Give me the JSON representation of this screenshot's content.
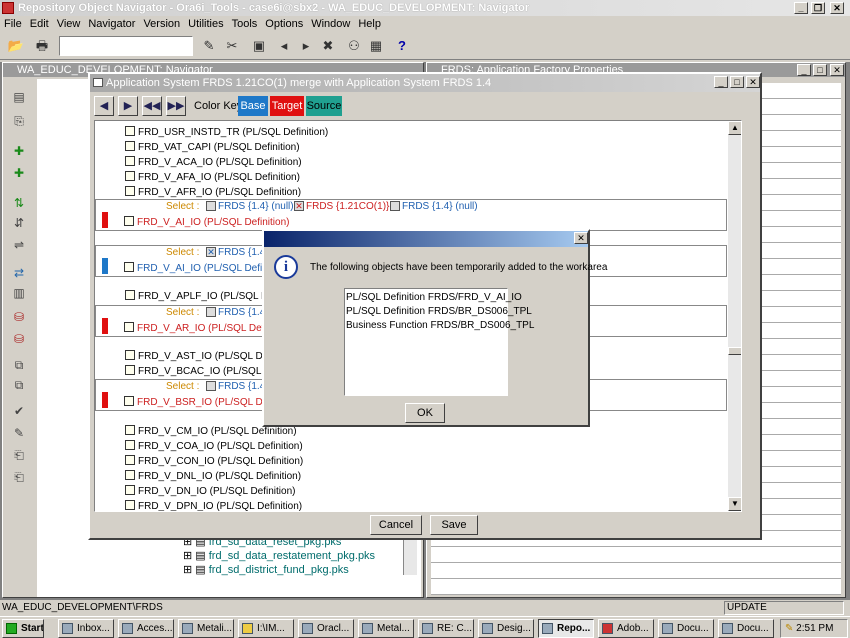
{
  "app": {
    "title": "Repository Object Navigator - Ora6i_Tools - case6i@sbx2 - WA_EDUC_DEVELOPMENT: Navigator"
  },
  "menu": [
    "File",
    "Edit",
    "View",
    "Navigator",
    "Version",
    "Utilities",
    "Tools",
    "Options",
    "Window",
    "Help"
  ],
  "left_window": {
    "title": "WA_EDUC_DEVELOPMENT: Navigator"
  },
  "right_window": {
    "title": "FRDS: Application Factory Properties"
  },
  "merge_dialog": {
    "title": "Application System  FRDS 1.21CO(1)  merge with Application System  FRDS 1.4",
    "color_key_label": "Color Key :",
    "key_base": "Base",
    "key_target": "Target",
    "key_source": "Source",
    "rows": [
      "FRD_USR_INSTD_TR (PL/SQL Definition)",
      "FRD_VAT_CAPI (PL/SQL Definition)",
      "FRD_V_ACA_IO (PL/SQL Definition)",
      "FRD_V_AFA_IO (PL/SQL Definition)",
      "FRD_V_AFR_IO (PL/SQL Definition)",
      "FRD_V_AI_IO (PL/SQL Definition)",
      "FRD_V_AI_IO (PL/SQL Definitio",
      "FRD_V_APLF_IO (PL/SQL Defin",
      "FRD_V_AR_IO (PL/SQL Definiti",
      "FRD_V_AST_IO (PL/SQL Defini",
      "FRD_V_BCAC_IO (PL/SQL Defin",
      "FRD_V_BSR_IO (PL/SQL Definiti",
      "FRD_V_CM_IO (PL/SQL Definition)",
      "FRD_V_COA_IO (PL/SQL Definition)",
      "FRD_V_CON_IO (PL/SQL Definition)",
      "FRD_V_DNL_IO (PL/SQL Definition)",
      "FRD_V_DN_IO (PL/SQL Definition)",
      "FRD_V_DPN_IO (PL/SQL Definition)"
    ],
    "select_label": "Select :",
    "sel1_base": "FRDS {1.4} (null)",
    "sel1_target": "FRDS {1.21CO(1)}",
    "sel1_source": "FRDS {1.4} (null)",
    "sel_frds": "FRDS {1.4}",
    "cancel": "Cancel",
    "save": "Save"
  },
  "bg_tree": [
    "frd_sd_data_reset_pkg.pks",
    "frd_sd_data_restatement_pkg.pks",
    "frd_sd_district_fund_pkg.pks"
  ],
  "message": {
    "text": "The following objects have been temporarily added to the workarea",
    "items": [
      "PL/SQL Definition FRDS/FRD_V_AI_IO",
      "PL/SQL Definition FRDS/BR_DS006_TPL",
      "Business Function FRDS/BR_DS006_TPL"
    ],
    "ok": "OK"
  },
  "status": {
    "path": "WA_EDUC_DEVELOPMENT\\FRDS",
    "mode": "UPDATE"
  },
  "taskbar": {
    "start": "Start",
    "tasks": [
      "Inbox...",
      "Acces...",
      "Metali...",
      "I:\\IM...",
      "Oracl...",
      "Metal...",
      "RE: C...",
      "Desig...",
      "Repo...",
      "Adob...",
      "Docu...",
      "Docu..."
    ],
    "clock": "2:51 PM"
  },
  "colors": {
    "base": "#1e78c8",
    "target": "#e01010",
    "source": "#20a090",
    "target_text": "#cc2020",
    "base_text": "#2060b0"
  }
}
